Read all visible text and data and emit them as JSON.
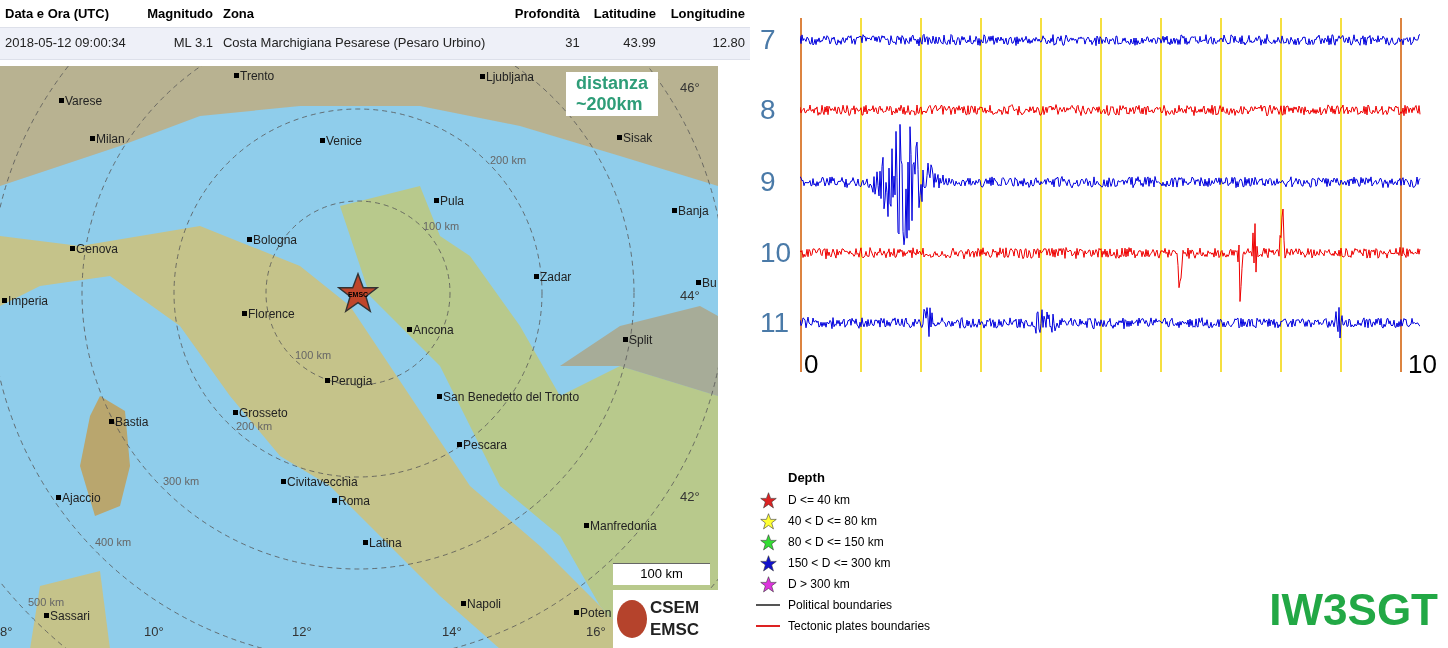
{
  "table": {
    "columns": [
      "Data e Ora (UTC)",
      "Magnitudo",
      "Zona",
      "Profondità",
      "Latitudine",
      "Longitudine"
    ],
    "rows": [
      [
        "2018-05-12 09:00:34",
        "ML 3.1",
        "Costa Marchigiana Pesarese (Pesaro Urbino)",
        "31",
        "43.99",
        "12.80"
      ]
    ]
  },
  "map": {
    "labels": [
      {
        "kind": "city",
        "text": "Trento"
      },
      {
        "kind": "city",
        "text": "Ljubljana"
      },
      {
        "kind": "city",
        "text": "Varese"
      },
      {
        "kind": "city",
        "text": "Milan"
      },
      {
        "kind": "city",
        "text": "Venice"
      },
      {
        "kind": "city",
        "text": "Sisak"
      },
      {
        "kind": "city",
        "text": "Pula"
      },
      {
        "kind": "city",
        "text": "Banja"
      },
      {
        "kind": "city",
        "text": "Bologna"
      },
      {
        "kind": "city",
        "text": "Genova"
      },
      {
        "kind": "city",
        "text": "Zadar"
      },
      {
        "kind": "city",
        "text": "Bu"
      },
      {
        "kind": "city",
        "text": "Imperia"
      },
      {
        "kind": "city",
        "text": "Florence"
      },
      {
        "kind": "city",
        "text": "Ancona"
      },
      {
        "kind": "city",
        "text": "Split"
      },
      {
        "kind": "city",
        "text": "Perugia"
      },
      {
        "kind": "city",
        "text": "San Benedetto del Tronto"
      },
      {
        "kind": "city",
        "text": "Bastia"
      },
      {
        "kind": "city",
        "text": "Grosseto"
      },
      {
        "kind": "city",
        "text": "Pescara"
      },
      {
        "kind": "city",
        "text": "Civitavecchia"
      },
      {
        "kind": "city",
        "text": "Ajaccio"
      },
      {
        "kind": "city",
        "text": "Roma"
      },
      {
        "kind": "city",
        "text": "Manfredonia"
      },
      {
        "kind": "city",
        "text": "Latina"
      },
      {
        "kind": "city",
        "text": "Napoli"
      },
      {
        "kind": "city",
        "text": "Sassari"
      },
      {
        "kind": "city",
        "text": "Poten"
      },
      {
        "kind": "ring",
        "text": "200 km"
      },
      {
        "kind": "ring",
        "text": "100 km"
      },
      {
        "kind": "ring",
        "text": "100 km"
      },
      {
        "kind": "ring",
        "text": "200 km"
      },
      {
        "kind": "ring",
        "text": "300 km"
      },
      {
        "kind": "ring",
        "text": "400 km"
      },
      {
        "kind": "ring",
        "text": "500 km"
      },
      {
        "kind": "degree",
        "text": "46°"
      },
      {
        "kind": "degree",
        "text": "44°"
      },
      {
        "kind": "degree",
        "text": "42°"
      },
      {
        "kind": "degree",
        "text": "8°"
      },
      {
        "kind": "degree",
        "text": "10°"
      },
      {
        "kind": "degree",
        "text": "12°"
      },
      {
        "kind": "degree",
        "text": "14°"
      },
      {
        "kind": "degree",
        "text": "16°"
      }
    ],
    "epicenter_label": "EMSC",
    "distance_note": [
      "distanza",
      "~200km"
    ],
    "scale": "100 km",
    "logo": [
      "CSEM",
      "EMSC"
    ]
  },
  "seismogram": {
    "channels": [
      {
        "label": "7",
        "color": "#0000dd"
      },
      {
        "label": "8",
        "color": "#ee0000"
      },
      {
        "label": "9",
        "color": "#0000dd"
      },
      {
        "label": "10",
        "color": "#ee0000"
      },
      {
        "label": "11",
        "color": "#0000dd"
      }
    ],
    "x_labels": [
      "0",
      "10"
    ]
  },
  "legend": {
    "title": "Depth",
    "items": [
      {
        "kind": "star",
        "color": "#dd2222",
        "label": "D <= 40 km"
      },
      {
        "kind": "star",
        "color": "#ffff33",
        "label": "40 < D <= 80 km"
      },
      {
        "kind": "star",
        "color": "#33dd33",
        "label": "80 < D <= 150 km"
      },
      {
        "kind": "star",
        "color": "#1111cc",
        "label": "150 < D <= 300 km"
      },
      {
        "kind": "star",
        "color": "#dd33dd",
        "label": "D > 300 km"
      },
      {
        "kind": "line",
        "color": "#555555",
        "label": "Political boundaries"
      },
      {
        "kind": "line",
        "color": "#dd2222",
        "label": "Tectonic plates boundaries"
      }
    ]
  },
  "callsign": "IW3SGT"
}
